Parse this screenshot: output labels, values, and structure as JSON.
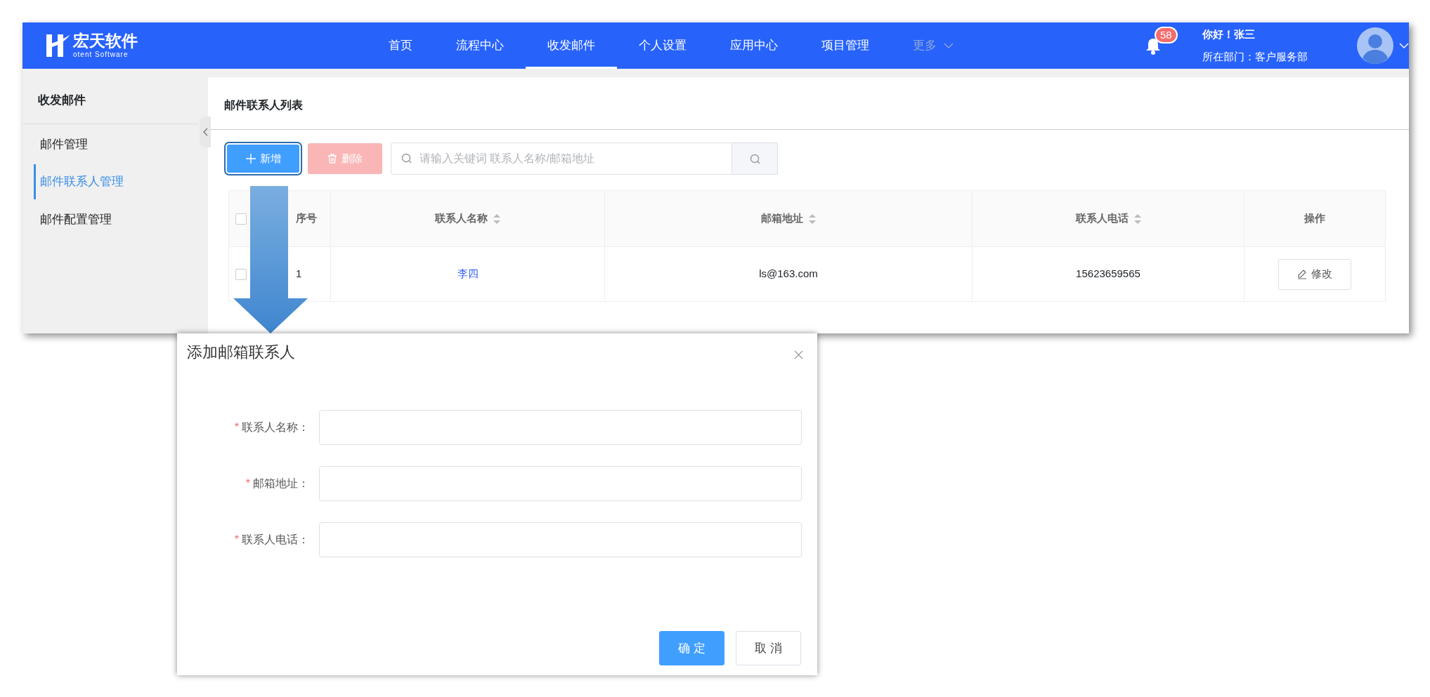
{
  "header": {
    "logo_title": "宏天软件",
    "logo_subtitle": "otent Software",
    "nav": [
      {
        "label": "首页",
        "selected": false,
        "disabled": false,
        "dropdown": false
      },
      {
        "label": "流程中心",
        "selected": false,
        "disabled": false,
        "dropdown": false
      },
      {
        "label": "收发邮件",
        "selected": true,
        "disabled": false,
        "dropdown": false
      },
      {
        "label": "个人设置",
        "selected": false,
        "disabled": false,
        "dropdown": false
      },
      {
        "label": "应用中心",
        "selected": false,
        "disabled": false,
        "dropdown": false
      },
      {
        "label": "项目管理",
        "selected": false,
        "disabled": false,
        "dropdown": false
      },
      {
        "label": "更多",
        "selected": false,
        "disabled": true,
        "dropdown": true
      }
    ],
    "notification_count": "58",
    "greeting": "你好！张三",
    "department": "所在部门：客户服务部"
  },
  "sidebar": {
    "title": "收发邮件",
    "items": [
      {
        "label": "邮件管理",
        "selected": false
      },
      {
        "label": "邮件联系人管理",
        "selected": true
      },
      {
        "label": "邮件配置管理",
        "selected": false
      }
    ]
  },
  "main": {
    "title": "邮件联系人列表",
    "toolbar": {
      "add_button": {
        "label": "新增",
        "focused": true
      },
      "delete_button": {
        "label": "删除",
        "disabled": true
      },
      "search": {
        "placeholder": "请输入关键词 联系人名称/邮箱地址"
      }
    },
    "table": {
      "select_all_checked": false,
      "columns": [
        {
          "label": "序号",
          "sortable": false
        },
        {
          "label": "联系人名称",
          "sortable": true
        },
        {
          "label": "邮箱地址",
          "sortable": true
        },
        {
          "label": "联系人电话",
          "sortable": true
        },
        {
          "label": "操作",
          "sortable": false
        }
      ],
      "rows": [
        {
          "checked": false,
          "cells": [
            "1",
            "李四",
            "ls@163.com",
            "15623659565"
          ],
          "action": "修改"
        }
      ]
    }
  },
  "dialog": {
    "title": "添加邮箱联系人",
    "fields": [
      {
        "label": "联系人名称：",
        "required_mark": "*"
      },
      {
        "label": "邮箱地址：",
        "required_mark": "*"
      },
      {
        "label": "联系人电话：",
        "required_mark": "*"
      }
    ],
    "buttons": [
      {
        "label": "确 定",
        "kind": "primary"
      },
      {
        "label": "取 消",
        "kind": "default"
      }
    ]
  }
}
